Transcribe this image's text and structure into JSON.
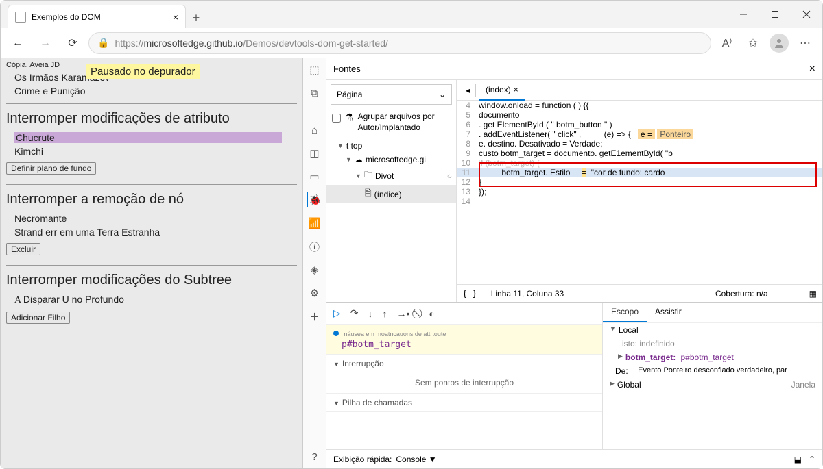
{
  "browser": {
    "tab_title": "Exemplos do DOM",
    "url_host": "microsoftedge.github.io",
    "url_path": "/Demos/devtools-dom-get-started/",
    "url_proto": "https://"
  },
  "page": {
    "small": "Cópia. Aveia JD",
    "banner": "Pausado no depurador",
    "p1": "Os Irmãos Karamazov",
    "p2": "Crime e Punição",
    "h1": "Interromper modificações de atributo",
    "hl": "Chucrute",
    "p3": "Kimchi",
    "btn1": "Definir plano de fundo",
    "h2": "Interromper a remoção de nó",
    "p4": "Necromante",
    "p5": "Strand err em uma Terra Estranha",
    "btn2": "Excluir",
    "h3": "Interromper modificações do Subtree",
    "p6": "Disparar U no Profundo",
    "btn3": "Adicionar Filho"
  },
  "devtools": {
    "title": "Fontes",
    "sidebar": {
      "pagina": "Página",
      "group": "Agrupar arquivos por Autor/Implantado",
      "top": "t top",
      "host": "microsoftedge.gi",
      "folder": "Divot",
      "file": "(índice)"
    },
    "editor": {
      "tab": "(index)",
      "lines": {
        "l4": "window.onload = function ( ) {{",
        "l5": "    documento",
        "l6": "        . get ElementById ( \" botm_button \" )",
        "l7a": "        . addEventListener( \" click\" ,",
        "l7b": "(e)  =>  {",
        "l7e": "e   =",
        "l7p": "Ponteiro",
        "l8": "            e. destino. Desativado     =  Verdade;",
        "l9": "            custo botm_target = documento. getE1ementById( \"b",
        "l10": "            if (botm_target) {",
        "l11a": "botm_target. Estilo",
        "l11b": "\"cor de fundo: cardo",
        "l12": "            }",
        "l13": "        });",
        "l14": ""
      },
      "status_line": "Linha 11, Coluna 33",
      "coverage": "Cobertura: n/a"
    },
    "debugger": {
      "pause_small": "náusea em moatncauons de attrtoute",
      "pause_el": "p#botm_target",
      "sec1": "Interrupção",
      "sec1_body": "Sem pontos de interrupção",
      "sec2": "Pilha de chamadas"
    },
    "scope": {
      "tab1": "Escopo",
      "tab2": "Assistir",
      "local": "Local",
      "this": "isto: indefinido",
      "bt_k": "botm_target:",
      "bt_v": "p#botm_target",
      "de": "De:",
      "de_v": "Evento Ponteiro desconfiado verdadeiro, par",
      "global": "Global",
      "global_v": "Janela"
    },
    "drawer": {
      "label": "Exibição rápida:",
      "val": "Console"
    }
  }
}
